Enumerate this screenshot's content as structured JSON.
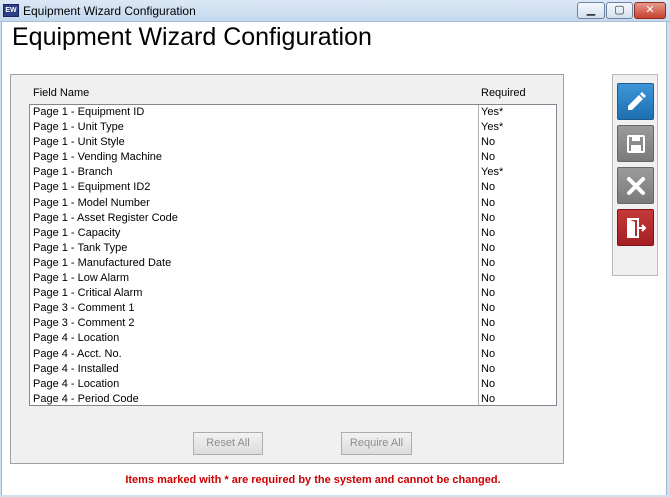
{
  "window": {
    "icon_label": "EW",
    "title": "Equipment Wizard Configuration",
    "minimize_glyph": "▁",
    "maximize_glyph": "▢",
    "close_glyph": "✕"
  },
  "page_title": "Equipment Wizard Configuration",
  "table": {
    "headers": {
      "field": "Field Name",
      "required": "Required"
    },
    "rows": [
      {
        "field": "Page 1 - Equipment ID",
        "required": "Yes*"
      },
      {
        "field": "Page 1 - Unit Type",
        "required": "Yes*"
      },
      {
        "field": "Page 1 - Unit Style",
        "required": "No"
      },
      {
        "field": "Page 1 - Vending Machine",
        "required": "No"
      },
      {
        "field": "Page 1 - Branch",
        "required": "Yes*"
      },
      {
        "field": "Page 1 - Equipment ID2",
        "required": "No"
      },
      {
        "field": "Page 1 - Model Number",
        "required": "No"
      },
      {
        "field": "Page 1 - Asset Register Code",
        "required": "No"
      },
      {
        "field": "Page 1 - Capacity",
        "required": "No"
      },
      {
        "field": "Page 1 - Tank Type",
        "required": "No"
      },
      {
        "field": "Page 1 - Manufactured Date",
        "required": "No"
      },
      {
        "field": "Page 1 - Low Alarm",
        "required": "No"
      },
      {
        "field": "Page 1 - Critical Alarm",
        "required": "No"
      },
      {
        "field": "Page 3 - Comment 1",
        "required": "No"
      },
      {
        "field": "Page 3 - Comment 2",
        "required": "No"
      },
      {
        "field": "Page 4 - Location",
        "required": "No"
      },
      {
        "field": "Page 4 - Acct. No.",
        "required": "No"
      },
      {
        "field": "Page 4 - Installed",
        "required": "No"
      },
      {
        "field": "Page 4 - Location",
        "required": "No"
      },
      {
        "field": "Page 4 - Period Code",
        "required": "No"
      }
    ]
  },
  "buttons": {
    "reset_all": "Reset All",
    "require_all": "Require All"
  },
  "toolbar": {
    "edit_icon": "pencil-icon",
    "save_icon": "floppy-disk-icon",
    "cancel_icon": "x-icon",
    "exit_icon": "exit-door-icon",
    "colors": {
      "edit": "#2a83c6",
      "save": "#8a8a8a",
      "cancel": "#8a8a8a",
      "exit": "#b3262b"
    }
  },
  "footer_note": "Items marked with * are required by the system and cannot be changed.",
  "colors": {
    "note": "#cc0000",
    "titlebar": "#c4d8ee"
  }
}
